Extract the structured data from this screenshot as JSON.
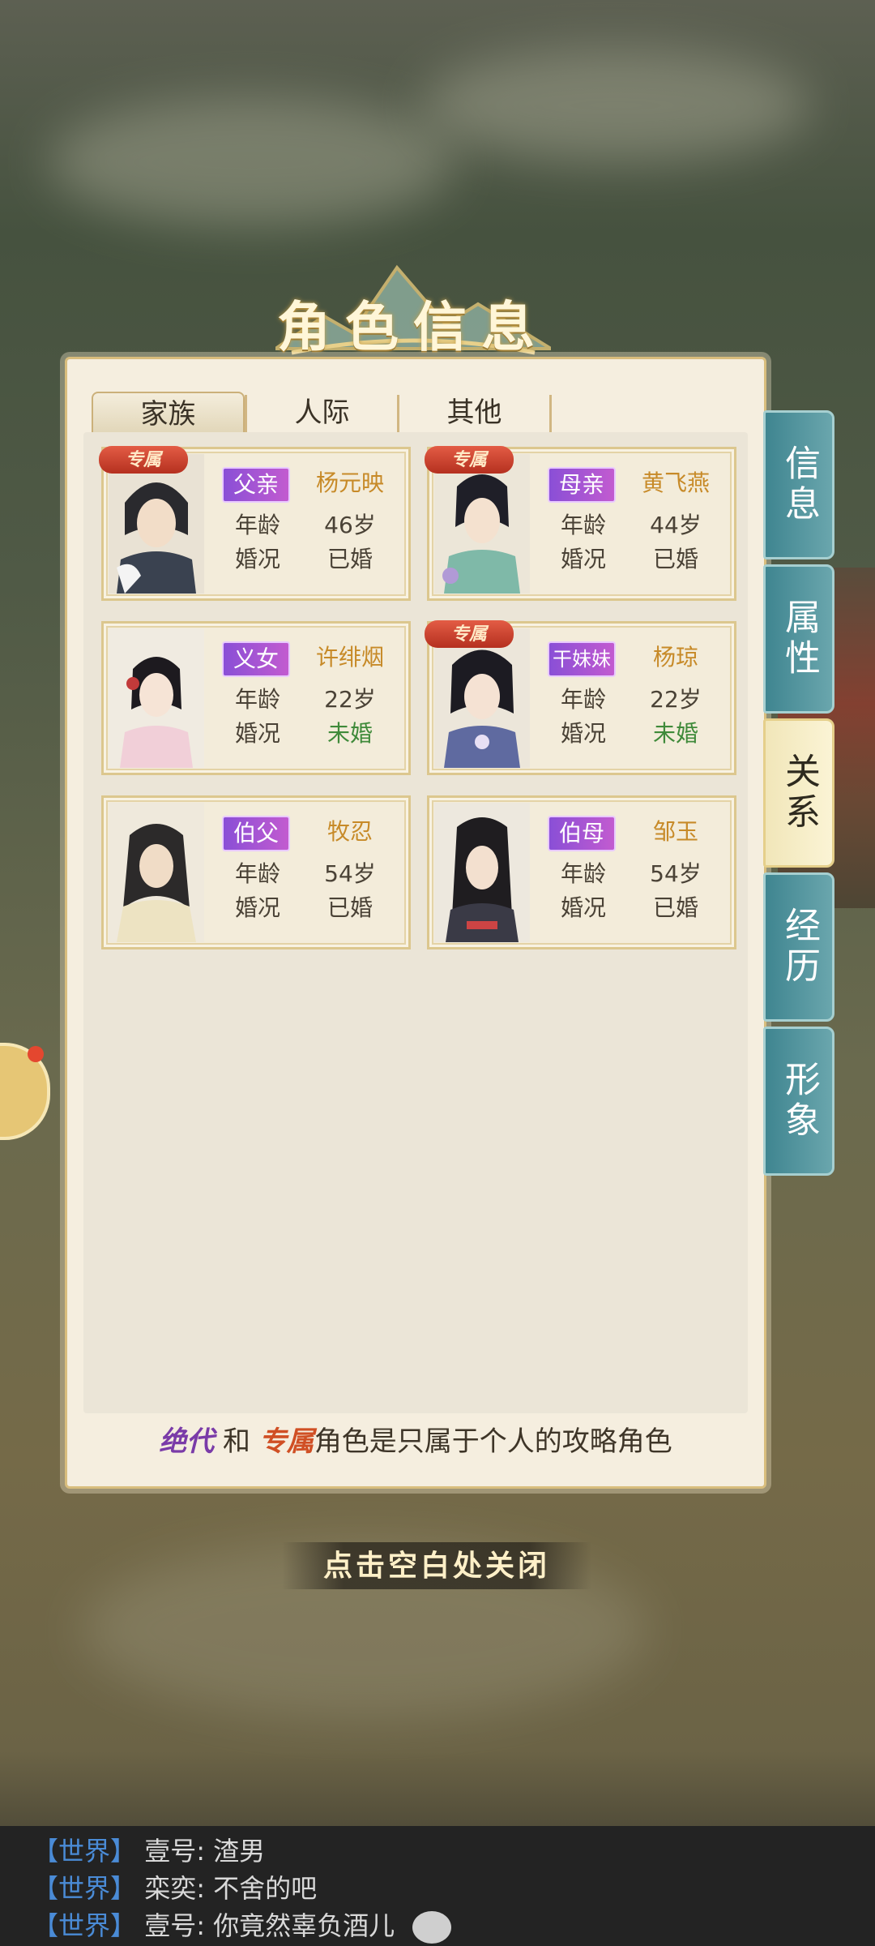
{
  "title": "角色信息",
  "tabs": [
    {
      "label": "家族",
      "active": true
    },
    {
      "label": "人际",
      "active": false
    },
    {
      "label": "其他",
      "active": false
    }
  ],
  "side_tabs": [
    {
      "label": "信息",
      "active": false
    },
    {
      "label": "属性",
      "active": false
    },
    {
      "label": "关系",
      "active": true
    },
    {
      "label": "经历",
      "active": false
    },
    {
      "label": "形象",
      "active": false
    }
  ],
  "labels": {
    "age": "年龄",
    "marriage": "婚况",
    "exclusive_badge": "专属"
  },
  "cards": [
    {
      "relation": "父亲",
      "name": "杨元映",
      "age": "46岁",
      "marriage": "已婚",
      "exclusive": true
    },
    {
      "relation": "母亲",
      "name": "黄飞燕",
      "age": "44岁",
      "marriage": "已婚",
      "exclusive": true
    },
    {
      "relation": "义女",
      "name": "许绯烟",
      "age": "22岁",
      "marriage": "未婚",
      "exclusive": false
    },
    {
      "relation": "干妹妹",
      "name": "杨琼",
      "age": "22岁",
      "marriage": "未婚",
      "exclusive": true
    },
    {
      "relation": "伯父",
      "name": "牧忍",
      "age": "54岁",
      "marriage": "已婚",
      "exclusive": false
    },
    {
      "relation": "伯母",
      "name": "邹玉",
      "age": "54岁",
      "marriage": "已婚",
      "exclusive": false
    }
  ],
  "footer": {
    "jd": "绝代",
    "and": " 和 ",
    "zs": "专属",
    "rest": "角色是只属于个人的攻略角色"
  },
  "close_hint": "点击空白处关闭",
  "chat": [
    {
      "channel": "【世界】",
      "user": "壹号:",
      "text": "渣男"
    },
    {
      "channel": "【世界】",
      "user": "栾奕:",
      "text": "不舍的吧"
    },
    {
      "channel": "【世界】",
      "user": "壹号:",
      "text": "你竟然辜负酒儿"
    }
  ],
  "colors": {
    "accent_gold": "#c78a28",
    "relation_badge": "#8a4fd6",
    "single_green": "#3f8a3a",
    "side_tab_teal": "#3f8590"
  }
}
